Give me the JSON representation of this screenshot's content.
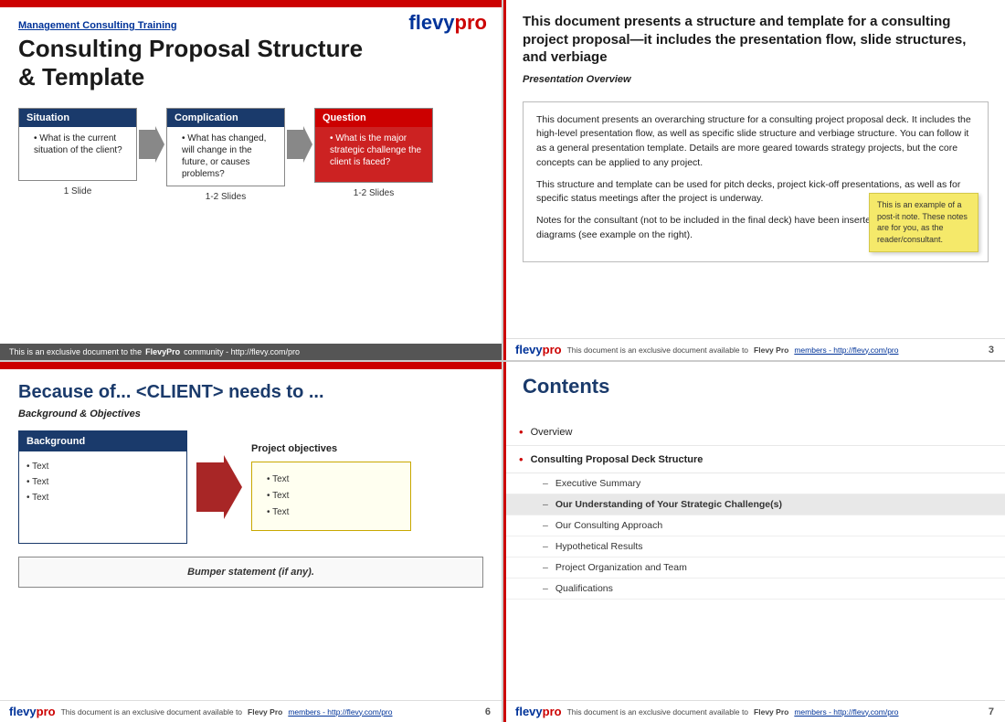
{
  "slide1": {
    "logo": {
      "flevy": "flevy",
      "pro": "pro"
    },
    "subtitle_link": "Management Consulting Training",
    "main_title": "Consulting Proposal Structure\n& Template",
    "flow_boxes": [
      {
        "id": "situation",
        "header": "Situation",
        "bullet": "What is the current situation of the client?",
        "count": "1 Slide",
        "color": "situation"
      },
      {
        "id": "complication",
        "header": "Complication",
        "bullet": "What has changed, will change in the future, or causes problems?",
        "count": "1-2 Slides",
        "color": "complication"
      },
      {
        "id": "question",
        "header": "Question",
        "bullet": "What is the major strategic challenge the client is faced?",
        "count": "1-2 Slides",
        "color": "question"
      }
    ],
    "footer_text": "This is an exclusive document to the ",
    "footer_bold": "FlevyPro",
    "footer_url": "community - http://flevy.com/pro"
  },
  "slide2": {
    "big_title": "This document presents a structure and template for a consulting project\nproposal—it includes the presentation flow, slide structures, and verbiage",
    "section_label": "Presentation Overview",
    "para1": "This document presents an overarching structure for a consulting project proposal deck.  It includes the high-level presentation flow, as well as specific slide structure and verbiage structure.  You can follow it as a general presentation template.  Details are more geared towards strategy projects, but the core concepts can be applied to any project.",
    "para2": "This structure and template can be used for pitch decks, project kick-off presentations, as well as for specific status meetings after the project is underway.",
    "para3": "Notes for the consultant (not to be included in the final deck) have been inserted in the post-it note diagrams (see example on the right).",
    "postit_text": "This is an example of a post-it note.  These notes are for you, as the reader/consultant.",
    "footer_doc": "This document is an exclusive document available to ",
    "footer_bold": "Flevy Pro",
    "footer_url": " members - http://flevy.com/pro",
    "page_num": "3"
  },
  "slide3": {
    "slide_title": "Because of... <CLIENT> needs to ...",
    "section_label": "Background & Objectives",
    "bg_header": "Background",
    "bg_items": [
      "Text",
      "Text",
      "Text"
    ],
    "obj_label": "Project objectives",
    "obj_items": [
      "Text",
      "Text",
      "Text"
    ],
    "bumper_text": "Bumper statement (if any).",
    "footer_doc": "This document is an exclusive document available to ",
    "footer_bold": "Flevy Pro",
    "footer_url": " members - http://flevy.com/pro",
    "page_num": "6"
  },
  "slide4": {
    "slide_title": "Contents",
    "toc": [
      {
        "type": "item",
        "bullet": true,
        "text": "Overview",
        "highlighted": false
      },
      {
        "type": "item",
        "bullet": true,
        "text": "Consulting Proposal Deck Structure",
        "bold": true,
        "highlighted": false
      },
      {
        "type": "sub",
        "text": "Executive Summary",
        "highlighted": false
      },
      {
        "type": "sub",
        "text": "Our Understanding of Your Strategic Challenge(s)",
        "highlighted": true
      },
      {
        "type": "sub",
        "text": "Our Consulting Approach",
        "highlighted": false
      },
      {
        "type": "sub",
        "text": "Hypothetical Results",
        "highlighted": false
      },
      {
        "type": "sub",
        "text": "Project Organization and Team",
        "highlighted": false
      },
      {
        "type": "sub",
        "text": "Qualifications",
        "highlighted": false
      }
    ],
    "footer_doc": "This document is an exclusive document available to ",
    "footer_bold": "Flevy Pro",
    "footer_url": " members - http://flevy.com/pro",
    "page_num": "7"
  }
}
